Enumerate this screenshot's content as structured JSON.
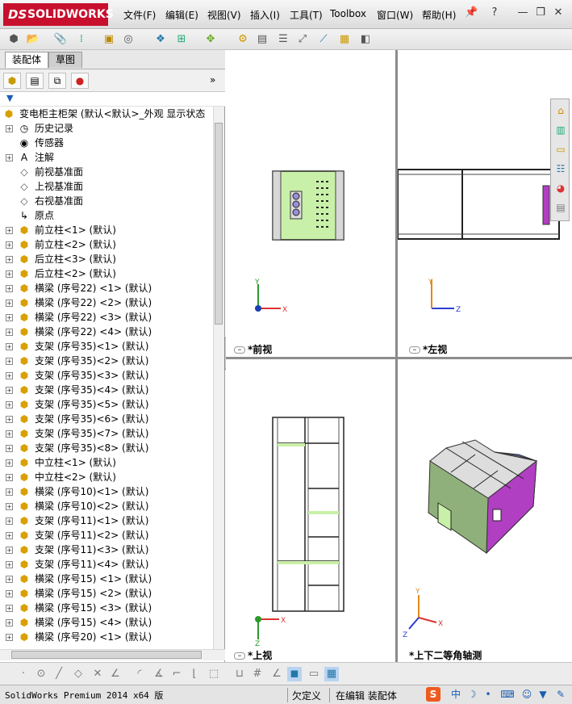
{
  "app": {
    "brand": "SOLIDWORKS",
    "brand_mark": "DS"
  },
  "menu": [
    "文件(F)",
    "编辑(E)",
    "视图(V)",
    "插入(I)",
    "工具(T)",
    "Toolbox",
    "窗口(W)",
    "帮助(H)"
  ],
  "window_controls": {
    "minimize": "—",
    "restore": "❐",
    "close": "✕"
  },
  "tabs": [
    {
      "label": "装配体"
    },
    {
      "label": "草图"
    }
  ],
  "tree": {
    "root": "变电柜主柜架  (默认<默认>_外观 显示状态",
    "items": [
      {
        "label": "历史记录",
        "icon": "history",
        "expand": true
      },
      {
        "label": "传感器",
        "icon": "sensor",
        "expand": false
      },
      {
        "label": "注解",
        "icon": "annotation",
        "expand": true
      },
      {
        "label": "前视基准面",
        "icon": "plane",
        "expand": false
      },
      {
        "label": "上视基准面",
        "icon": "plane",
        "expand": false
      },
      {
        "label": "右视基准面",
        "icon": "plane",
        "expand": false
      },
      {
        "label": "原点",
        "icon": "origin",
        "expand": false
      },
      {
        "label": "前立柱<1> (默认)",
        "icon": "part",
        "expand": true
      },
      {
        "label": "前立柱<2> (默认)",
        "icon": "part",
        "expand": true
      },
      {
        "label": "后立柱<3> (默认)",
        "icon": "part",
        "expand": true
      },
      {
        "label": "后立柱<2> (默认)",
        "icon": "part",
        "expand": true
      },
      {
        "label": "横梁 (序号22) <1> (默认)",
        "icon": "part",
        "expand": true
      },
      {
        "label": "横梁 (序号22) <2> (默认)",
        "icon": "part",
        "expand": true
      },
      {
        "label": "横梁 (序号22) <3> (默认)",
        "icon": "part",
        "expand": true
      },
      {
        "label": "横梁 (序号22) <4> (默认)",
        "icon": "part",
        "expand": true
      },
      {
        "label": "支架 (序号35)<1> (默认)",
        "icon": "part",
        "expand": true
      },
      {
        "label": "支架 (序号35)<2> (默认)",
        "icon": "part",
        "expand": true
      },
      {
        "label": "支架 (序号35)<3> (默认)",
        "icon": "part",
        "expand": true
      },
      {
        "label": "支架 (序号35)<4> (默认)",
        "icon": "part",
        "expand": true
      },
      {
        "label": "支架 (序号35)<5> (默认)",
        "icon": "part",
        "expand": true
      },
      {
        "label": "支架 (序号35)<6> (默认)",
        "icon": "part",
        "expand": true
      },
      {
        "label": "支架 (序号35)<7> (默认)",
        "icon": "part",
        "expand": true
      },
      {
        "label": "支架 (序号35)<8> (默认)",
        "icon": "part",
        "expand": true
      },
      {
        "label": "中立柱<1> (默认)",
        "icon": "part",
        "expand": true
      },
      {
        "label": "中立柱<2> (默认)",
        "icon": "part",
        "expand": true
      },
      {
        "label": "横梁 (序号10)<1> (默认)",
        "icon": "part",
        "expand": true
      },
      {
        "label": "横梁 (序号10)<2> (默认)",
        "icon": "part",
        "expand": true
      },
      {
        "label": "支架 (序号11)<1> (默认)",
        "icon": "part",
        "expand": true
      },
      {
        "label": "支架 (序号11)<2> (默认)",
        "icon": "part",
        "expand": true
      },
      {
        "label": "支架 (序号11)<3> (默认)",
        "icon": "part",
        "expand": true
      },
      {
        "label": "支架 (序号11)<4> (默认)",
        "icon": "part",
        "expand": true
      },
      {
        "label": "横梁 (序号15) <1> (默认)",
        "icon": "part",
        "expand": true
      },
      {
        "label": "横梁 (序号15) <2> (默认)",
        "icon": "part",
        "expand": true
      },
      {
        "label": "横梁 (序号15) <3> (默认)",
        "icon": "part",
        "expand": true
      },
      {
        "label": "横梁 (序号15) <4> (默认)",
        "icon": "part",
        "expand": true
      },
      {
        "label": "横梁 (序号20) <1> (默认)",
        "icon": "part",
        "expand": true
      }
    ]
  },
  "viewports": {
    "front": "*前视",
    "left": "*左视",
    "top": "*上视",
    "iso": "*上下二等角轴测",
    "axis_x": "X",
    "axis_y": "Y",
    "axis_z": "Z"
  },
  "status": {
    "product": "SolidWorks Premium 2014 x64 版",
    "state": "欠定义",
    "mode": "在编辑 装配体"
  },
  "colors": {
    "brand_red": "#c8102e",
    "part_green": "#c9f0a8",
    "part_magenta": "#b13fc2"
  }
}
